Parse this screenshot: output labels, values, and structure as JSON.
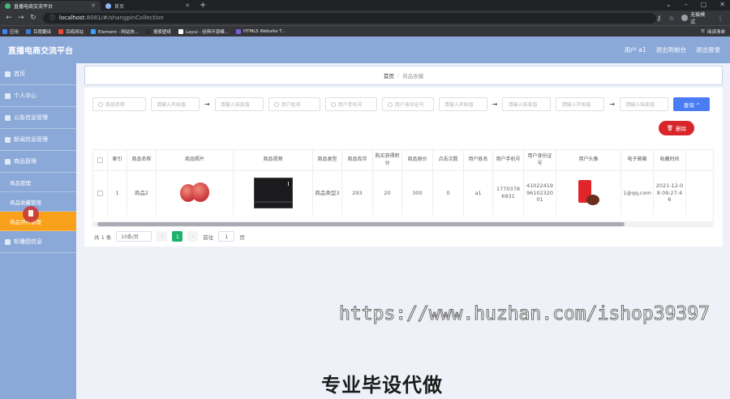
{
  "browser": {
    "tabs": [
      {
        "title": "直播电商交流平台",
        "active": true
      },
      {
        "title": "首页",
        "active": false
      }
    ],
    "new_tab": "+",
    "url_host": "localhost",
    "url_path": ":8081/#/shangpinCollection",
    "profile_label": "无痕模式",
    "bookmarks": [
      "应用",
      "百度翻译",
      "百练网站",
      "Element - 网站快...",
      "搜索壁纸",
      "Layui - 经典开源模...",
      "HTML5 Website T..."
    ],
    "reading_list": "阅读清单"
  },
  "header": {
    "brand": "直播电商交流平台",
    "links": [
      "用户 a1",
      "退出到前台",
      "退出登录"
    ]
  },
  "sidebar": {
    "items": [
      {
        "label": "首页"
      },
      {
        "label": "个人中心"
      },
      {
        "label": "公告信息管理"
      },
      {
        "label": "新闻信息管理"
      },
      {
        "label": "商品管理"
      }
    ],
    "sub_items": [
      {
        "label": "商品管理",
        "active": false
      },
      {
        "label": "商品收藏管理",
        "active": false
      },
      {
        "label": "商品评价管理",
        "active": true
      }
    ],
    "last_item": {
      "label": "轮播图信息"
    }
  },
  "breadcrumb": {
    "home": "首页",
    "sep": "/",
    "current": "商品收藏"
  },
  "filters": {
    "name_placeholder": "商品名称",
    "start1": "请输入开始值",
    "arrow": "→",
    "end1": "请输入结束值",
    "username_placeholder": "用户姓名",
    "phone_placeholder": "用户手机号",
    "id_placeholder": "用户身份证号",
    "start2": "请输入开始值",
    "end2": "请输入结束值",
    "start3": "请输入开始值",
    "end3": "请输入结束值",
    "query_label": "查询",
    "delete_label": "删除"
  },
  "table": {
    "columns": [
      "索引",
      "商品名称",
      "商品照片",
      "商品视频",
      "商品类型",
      "商品库存",
      "购买获得积分",
      "商品原价",
      "点击次数",
      "用户姓名",
      "用户手机号",
      "用户身份证号",
      "用户头像",
      "电子邮箱",
      "收藏时间"
    ],
    "rows": [
      {
        "index": "1",
        "name": "商品2",
        "type": "商品类型3",
        "stock": "293",
        "points": "20",
        "price": "300",
        "clicks": "0",
        "username": "a1",
        "phone": "17703786931",
        "idcard": "410224199610232001",
        "email": "1@qq.com",
        "time": "2021-12-08 09:27:46"
      }
    ]
  },
  "pagination": {
    "total": "共 1 条",
    "size": "10条/页",
    "prev": "‹",
    "current": "1",
    "next": "›",
    "goto": "前往",
    "goto_value": "1",
    "page_unit": "页"
  },
  "overlay": {
    "watermark": "https://www.huzhan.com/ishop39397",
    "caption": "专业毕设代做"
  },
  "colors": {
    "sidebar": "#8aa8d8",
    "active_menu": "#f9a11b",
    "primary": "#4a7cf3",
    "danger": "#d9262b",
    "page_active": "#20b16d"
  }
}
